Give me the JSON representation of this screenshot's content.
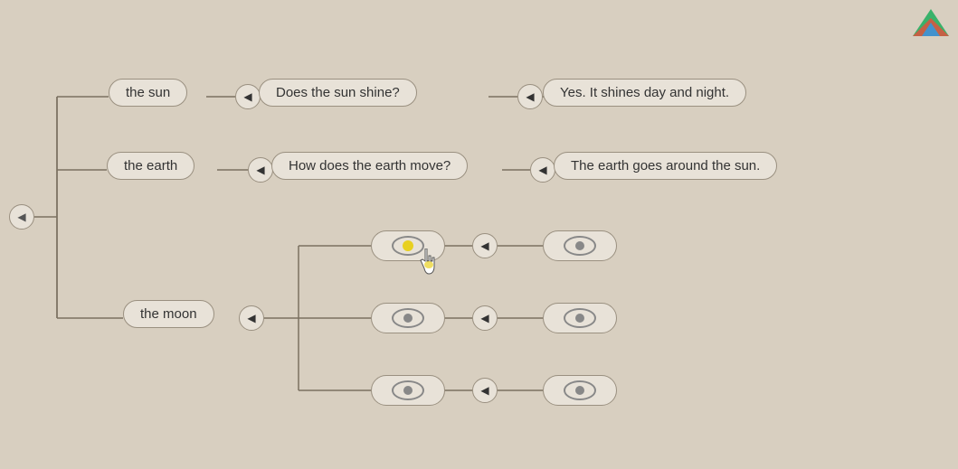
{
  "background": "#d8cfc0",
  "nodes": {
    "root_arrow": "◀",
    "the_sun": "the sun",
    "sun_arrow": "◀",
    "sun_question": "Does the sun shine?",
    "sun_q_arrow": "◀",
    "sun_answer": "Yes. It shines day and night.",
    "the_earth": "the earth",
    "earth_arrow": "◀",
    "earth_question": "How does the earth move?",
    "earth_q_arrow": "◀",
    "earth_answer": "The earth goes around the sun.",
    "the_moon": "the moon",
    "moon_arrow": "◀",
    "arrow_eye1": "◀",
    "arrow_eye2": "◀",
    "arrow_eye3": "◀"
  }
}
